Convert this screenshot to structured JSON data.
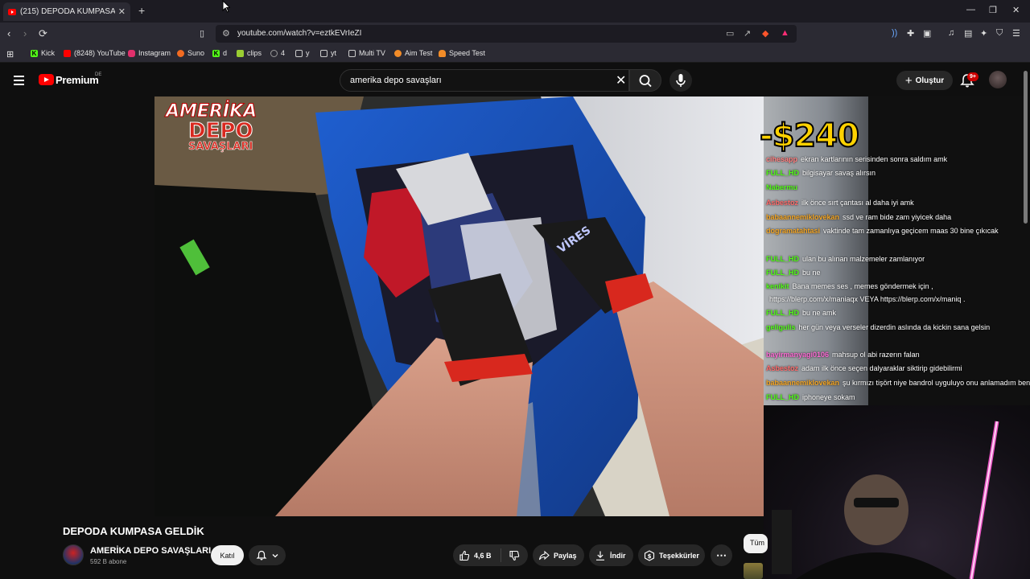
{
  "browser": {
    "tab_title": "(215) DEPODA KUMPASA GELDİK",
    "url": "youtube.com/watch?v=eztkEVrIeZI",
    "bookmarks": [
      {
        "label": "Kick",
        "icon": "kick-icon",
        "color": "#53fc18"
      },
      {
        "label": "(8248) YouTube",
        "icon": "youtube-icon",
        "color": "#ff0000"
      },
      {
        "label": "Instagram",
        "icon": "instagram-icon",
        "color": "#e1306c"
      },
      {
        "label": "Suno",
        "icon": "suno-icon",
        "color": "#f26b21"
      },
      {
        "label": "d",
        "icon": "kick-icon",
        "color": "#53fc18"
      },
      {
        "label": "clips",
        "icon": "clips-icon",
        "color": "#9acd32"
      },
      {
        "label": "4",
        "icon": "globe-icon",
        "color": "#999999"
      },
      {
        "label": "y",
        "icon": "folder-icon",
        "color": "#cccccc"
      },
      {
        "label": "yt",
        "icon": "folder-icon",
        "color": "#cccccc"
      },
      {
        "label": "Multi TV",
        "icon": "page-icon",
        "color": "#cccccc"
      },
      {
        "label": "Aim Test",
        "icon": "fox-icon",
        "color": "#f28c28"
      },
      {
        "label": "Speed Test",
        "icon": "cloud-icon",
        "color": "#f28c28"
      }
    ]
  },
  "youtube": {
    "logo_text": "Premium",
    "region": "DE",
    "search_query": "amerika depo savaşları",
    "create_label": "Oluştur",
    "notification_badge": "9+"
  },
  "video": {
    "overlay_title_line1": "AMERİKA",
    "overlay_title_line2": "DEPO",
    "overlay_title_line3": "SAVAŞLARI",
    "price_overlay": "-$240",
    "glove_text": "VİRES"
  },
  "chat": [
    {
      "user": "cihesapp",
      "text": "ekran kartlarının serisinden sonra saldım amk",
      "color": "#ff8080"
    },
    {
      "user": "FULL_HD",
      "text": "bilgisayar savaş alırsın",
      "color": "#53fc18"
    },
    {
      "user": "Nabermu",
      "text": "",
      "color": "#53fc18"
    },
    {
      "user": "Asbestoz",
      "text": "ilk önce sırt çantası al daha iyi amk",
      "color": "#ff6b6b"
    },
    {
      "user": "babaannemiklovekan",
      "text": "ssd ve ram bide zam yiyicek daha",
      "color": "#f5a623"
    },
    {
      "user": "dogramatahtasi",
      "text": "vaktinde tam zamanlıya geçicem maas 30 bine çıkıcak",
      "color": "#f5a623"
    },
    {
      "user": "FULL_HD",
      "text": "ulan bu alınan malzemeler zamlanıyor",
      "color": "#53fc18"
    },
    {
      "user": "FULL_HD",
      "text": "bu ne",
      "color": "#53fc18"
    },
    {
      "user": "kenikit",
      "text": "Bana memes ses , memes göndermek için ,",
      "color": "#53fc18"
    },
    {
      "user": "",
      "text": "https://blerp.com/x/maniaqx VEYA https://blerp.com/x/maniq .",
      "color": "#ffffff"
    },
    {
      "user": "FULL_HD",
      "text": "bu ne amk",
      "color": "#53fc18"
    },
    {
      "user": "geligulis",
      "text": "her gün veya verseler dizerdin aslında da kickin sana gelsin",
      "color": "#53fc18"
    },
    {
      "user": "bayirmanyagi0106",
      "text": "mahsup ol abi razerın falan",
      "color": "#ff6bd6"
    },
    {
      "user": "Asbestoz",
      "text": "adam ilk önce seçen dalyaraklar siktirip gidebilirmi",
      "color": "#ff6b6b"
    },
    {
      "user": "babaannemiklovekan",
      "text": "şu kırmızı tişört niye bandrol uyguluyo onu anlamadım ben",
      "color": "#f5a623"
    },
    {
      "user": "FULL_HD",
      "text": "iphoneye sokam",
      "color": "#53fc18"
    }
  ],
  "details": {
    "title": "DEPODA KUMPASA GELDİK",
    "channel_name": "AMERİKA DEPO SAVAŞLARI",
    "subscribers": "592 B abone",
    "join_label": "Katıl",
    "likes": "4,6 B",
    "share_label": "Paylaş",
    "download_label": "İndir",
    "thanks_label": "Teşekkürler",
    "tab_all": "Tüm"
  }
}
